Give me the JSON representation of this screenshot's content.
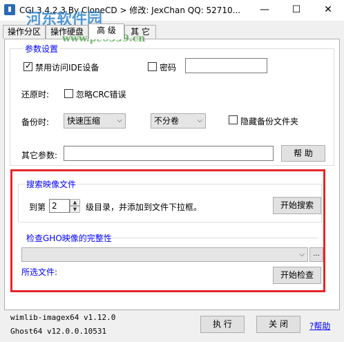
{
  "window": {
    "title": "CGI 3.4.2.3 By CloneCD > 修改: JexChan   QQ: 52710...",
    "minimize": "—",
    "maximize": "☐",
    "close": "✕"
  },
  "watermark": {
    "logo": "河东软件园",
    "url": "www.pc0359.cn"
  },
  "tabs": [
    "操作分区",
    "操作硬盘",
    "高 级",
    "其 它"
  ],
  "params": {
    "group_title": "参数设置",
    "disable_ide_label": "禁用访问IDE设备",
    "disable_ide_checked": true,
    "password_label": "密码",
    "password_checked": false,
    "password_value": "",
    "restore_label": "还原时:",
    "ignore_crc_label": "忽略CRC错误",
    "ignore_crc_checked": false,
    "backup_label": "备份时:",
    "compress_value": "快速压缩",
    "split_value": "不分卷",
    "hide_folder_label": "隐藏备份文件夹",
    "hide_folder_checked": false,
    "other_params_label": "其它参数:",
    "other_params_value": "",
    "help_button": "帮 助"
  },
  "search": {
    "group_title": "搜索映像文件",
    "to_label": "到第",
    "level_value": "2",
    "level_desc": "级目录，并添加到文件下拉框。",
    "start_button": "开始搜索"
  },
  "check": {
    "group_title": "检查GHO映像的完整性",
    "file_combo_value": "",
    "browse_button": "...",
    "selected_label": "所选文件:",
    "start_button": "开始检查"
  },
  "footer": {
    "wimlib_version": "wimlib-imagex64 v1.12.0",
    "ghost_version": "Ghost64 v12.0.0.10531",
    "execute_button": "执 行",
    "close_button": "关 闭",
    "help_link": "?帮助"
  }
}
